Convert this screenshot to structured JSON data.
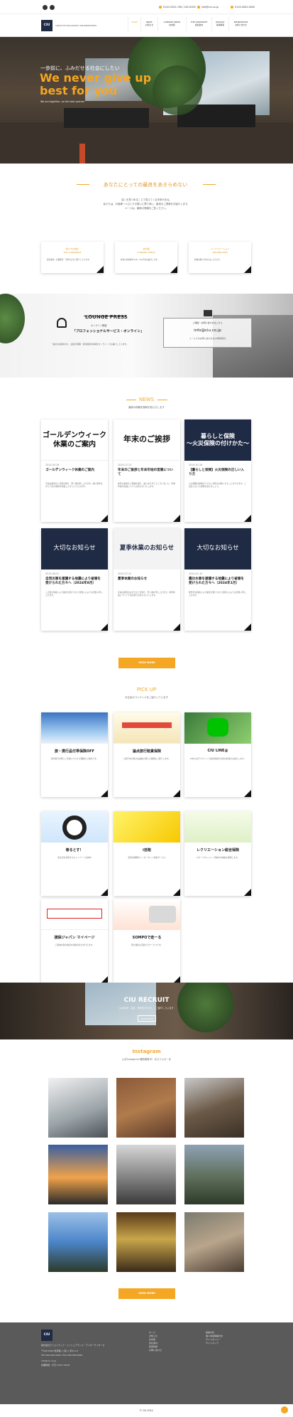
{
  "topbar": {
    "phone1": "0120-5332-706 / 042-0000",
    "email": "info@ciu.co.jp",
    "phone2": "0120-0000-0000"
  },
  "header": {
    "logo_text": "CIU",
    "logo_sub": "CREATIVE INSURANCE UNDERWRITERS",
    "nav": [
      {
        "en": "HOME",
        "ja": ""
      },
      {
        "en": "NEWS",
        "ja": "お知らせ"
      },
      {
        "en": "COMPANY PRESS",
        "ja": "社内報"
      },
      {
        "en": "THE CORPORATE",
        "ja": "会社案内"
      },
      {
        "en": "RECRUIT",
        "ja": "採用情報"
      },
      {
        "en": "INFORMATION",
        "ja": "お問い合わせ"
      }
    ]
  },
  "hero": {
    "small": "一歩前に、ふみだせる社会にしたい",
    "big": "We never give up best for you",
    "tiny": "We are together, as the best partner"
  },
  "intro": {
    "heading": "あなたにとっての最良をあきらめない",
    "lines": [
      "遠くを見つめることで見えてくる未来がある。",
      "私たちは、お客様一人ひとりの想いに寄り添い、最良のご提案をお届けします。",
      "ページは、最新の情報をご覧ください。"
    ]
  },
  "features": [
    {
      "title": "THE CORPORATE",
      "sub": "私たちの会社",
      "desc": "会社案内・企業理念・沿革などをご紹介しています。"
    },
    {
      "title": "COMPANY PRESS",
      "sub": "社内報",
      "desc": "社内の出来事やスタッフの声をお届けします。"
    },
    {
      "title": "INFORMATION",
      "sub": "インフォメーション",
      "desc": "各種お問い合わせはこちらから"
    }
  ],
  "lounge": {
    "title": "LOUNGE PRESS",
    "sub": "オンライン開催",
    "name": "「プロフェッショナルサービス・オンライン」",
    "desc": "一般のお客様向けに、最新の保険・資産運用の情報をオンラインでお届けしています。",
    "mail_label": "ご相談・お問い合わせはこちら",
    "mail": "info@ciu.co.jp",
    "mail_note": "メールでのお問い合わせは24時間受付"
  },
  "news": {
    "heading": "NEWS",
    "sub": "最新の情報を随時お知らせします",
    "items": [
      {
        "img": "ゴールデンウィーク\n休業のご案内",
        "date": "2024.04.26",
        "title": "ゴールデンウィーク休業のご案内",
        "body": "平素は格別のご高配を賜り、厚く御礼申し上げます。誠に勝手ながら下記の期間を休業とさせていただきます。"
      },
      {
        "img": "年末のご挨拶",
        "date": "2024.12.23",
        "title": "年末のご挨拶と年末年始の営業について",
        "body": "本年も格別のご愛顧を賜り、誠にありがとうございました。年末年始の営業についてお知らせいたします。"
      },
      {
        "img": "暮らしと保険\n〜火災保険の付けかた〜",
        "date": "2024.01.26",
        "title": "【暮らしと保険】火災保険の正しい入り方",
        "body": "火災保険は建物だけでなく家財も対象にすることができます。ご自身に合った補償を選びましょう。"
      },
      {
        "img": "大切なお知らせ",
        "date": "2024.08.01",
        "title": "自然災害を援護する地震により被害を受けられた方々へ（2024年8月）",
        "body": "この度の地震により被害を受けられた皆様に心よりお見舞い申し上げます。"
      },
      {
        "img": "夏季休業のお知らせ",
        "date": "2024.07.31",
        "title": "夏季休業のお知らせ",
        "body": "平素は格別のお引き立てを賜り、厚く御礼申し上げます。夏季休業について下記の通りお知らせいたします。"
      },
      {
        "img": "大切なお知らせ",
        "date": "2024.01.10",
        "title": "震災水害を援護する地震により被害を受けられた方々へ（2024年1月）",
        "body": "能登半島地震により被害を受けられた皆様に心よりお見舞い申し上げます。"
      }
    ],
    "button": "VIEW MORE"
  },
  "pickup": {
    "heading": "PICK UP",
    "sub": "今注目のコンテンツをご紹介しています",
    "items": [
      {
        "title": "旅・携行品付帯保険OFF",
        "body": "海外旅行の際にご活用いただける保険のご案内です。"
      },
      {
        "title": "論点旅行賠責保険",
        "body": "ご旅行中の思わぬ事故に備える保険をご紹介します。"
      },
      {
        "title": "CIU LINE@",
        "body": "LINE公式アカウントで最新情報やお得な情報をお届けします。"
      },
      {
        "title": "春るとす！",
        "body": "新生活を応援するキャンペーン実施中"
      },
      {
        "title": "i自賠",
        "body": "自賠責保険のインターネット契約サービス"
      },
      {
        "title": "レクリエーション総合保険",
        "body": "スポーツやレジャー活動中の事故を補償します。"
      },
      {
        "title": "損保ジャパン マイページ",
        "body": "ご契約内容の確認や各種手続きが行えます。"
      },
      {
        "title": "SOMPOで走ーる",
        "body": "安全運転を応援するサービスです。"
      }
    ]
  },
  "recruit": {
    "title": "CIU RECRUIT",
    "sub": "採用情報・募集・職場環境を詳しくご紹介しています",
    "button": "VIEW MORE"
  },
  "instagram": {
    "heading": "Instagram",
    "sub": "公式Instagram 随時更新中！ぜひフォローを",
    "button": "VIEW MORE"
  },
  "footer": {
    "logo": "CIU",
    "company": "株式会社クリエイティブ・インシュアランス・アンダーライターズ",
    "address": "〒000-0000 東京都○○区○○町0-0-0",
    "tel": "TEL 000-000-0000 / FAX 000-000-0000",
    "email": "info@ciu.co.jp",
    "hours": "営業時間：平日 9:00〜18:00",
    "links_col1": [
      "ホーム",
      "お知らせ",
      "社内報",
      "会社案内",
      "採用情報",
      "お問い合わせ"
    ],
    "links_col2": [
      "勧誘方針",
      "個人情報保護方針",
      "サイトポリシー",
      "サイトマップ"
    ],
    "copyright": "© CIU 2024."
  },
  "colors": {
    "accent": "#f5a623",
    "navy": "#1f2a44"
  }
}
